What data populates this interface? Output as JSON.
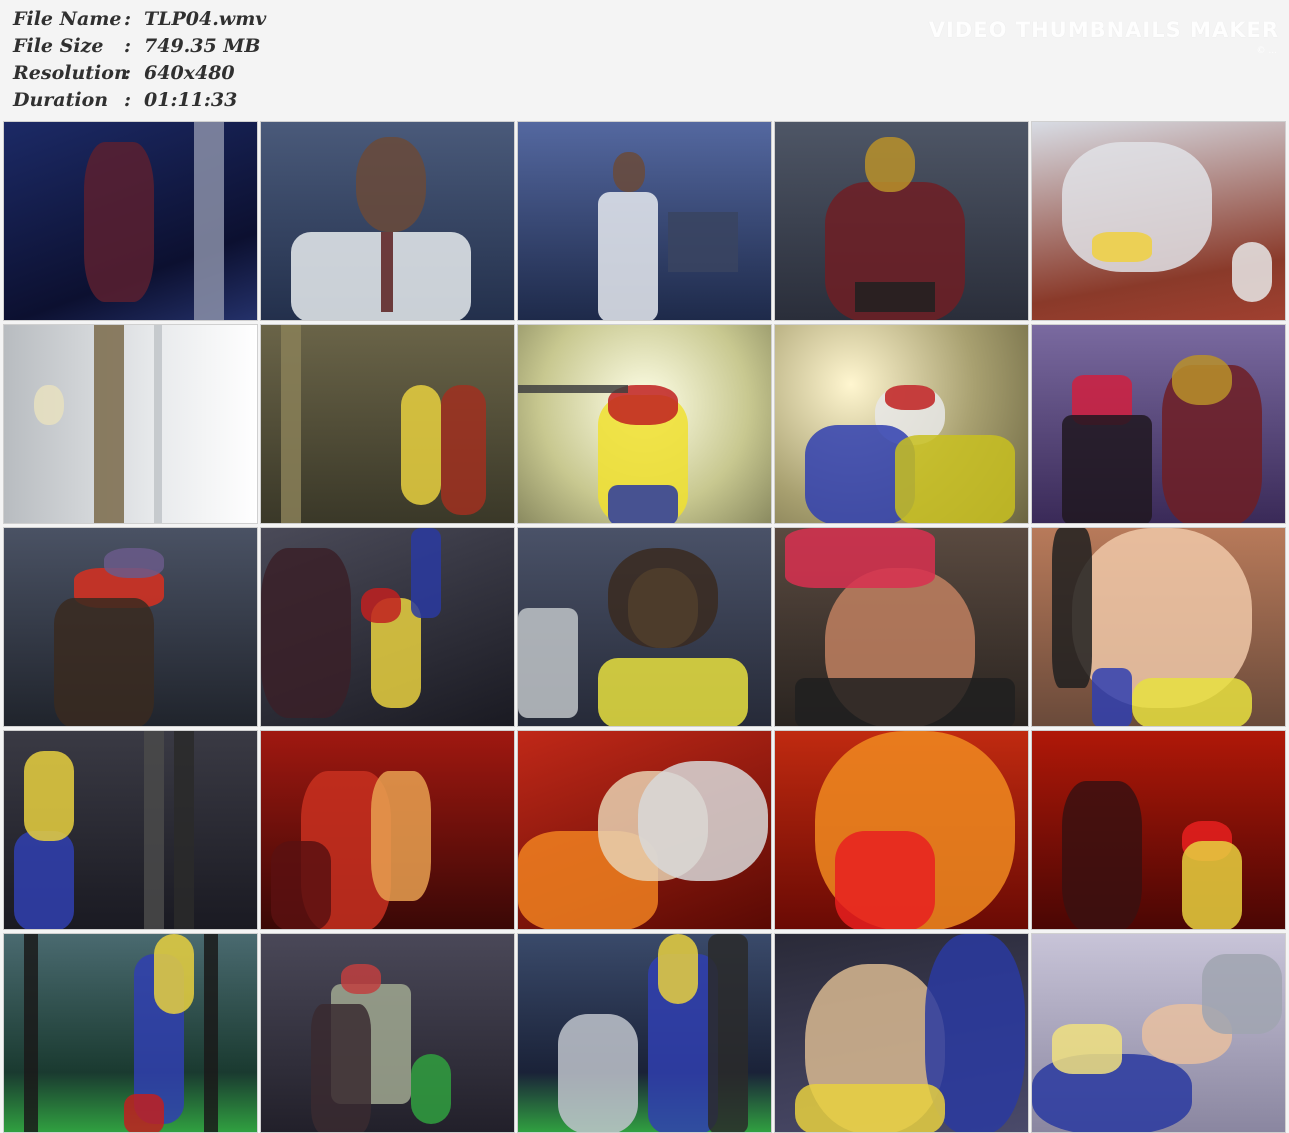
{
  "info": {
    "file_name_label": "File Name",
    "file_name": "TLP04.wmv",
    "file_size_label": "File Size",
    "file_size": "749.35 MB",
    "resolution_label": "Resolution",
    "resolution": "640x480",
    "duration_label": "Duration",
    "duration": "01:11:33",
    "separator": ":"
  },
  "watermark": {
    "title": "VIDEO THUMBNAILS MAKER",
    "subtitle": "© ..."
  }
}
